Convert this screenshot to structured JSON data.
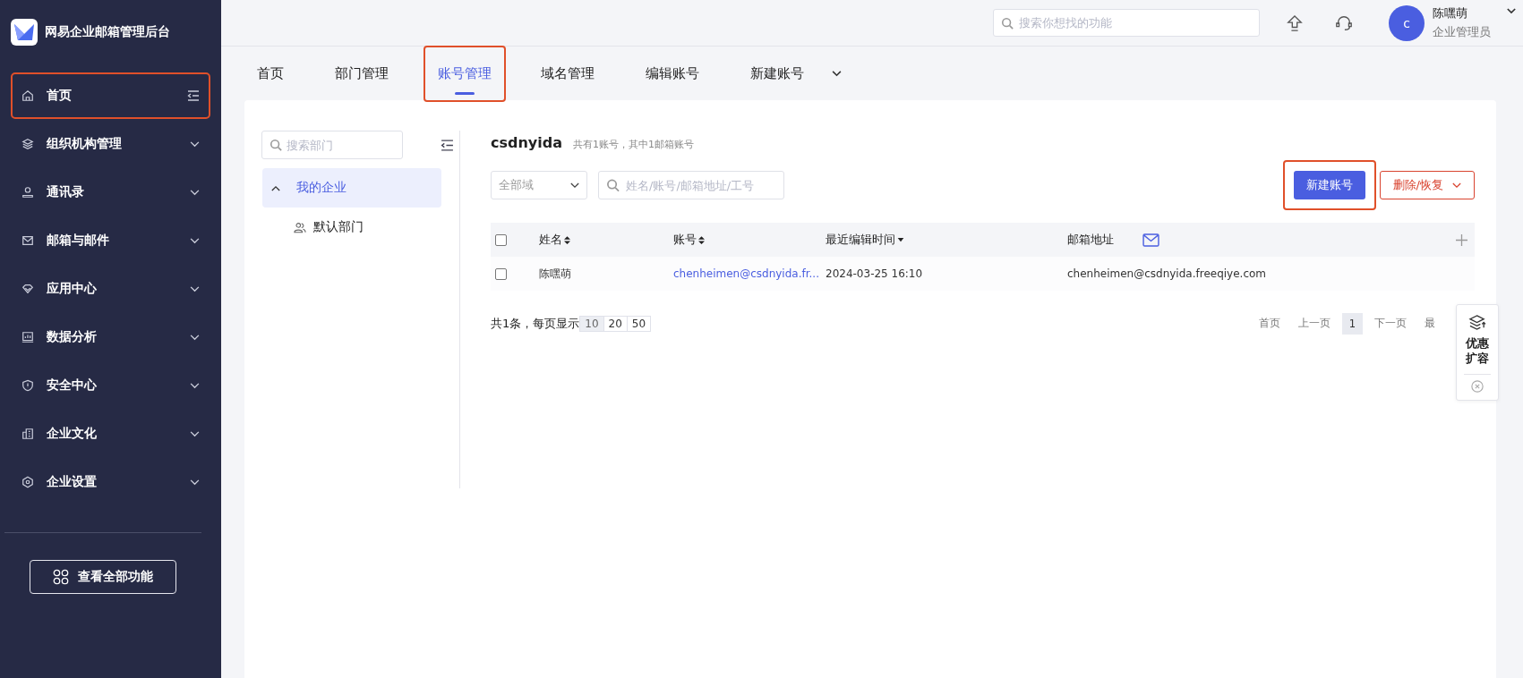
{
  "app": {
    "title": "网易企业邮箱管理后台"
  },
  "sidebar": {
    "items": [
      {
        "label": "首页",
        "kind": "collapse",
        "highlighted": true
      },
      {
        "label": "组织机构管理",
        "kind": "expand",
        "highlighted": false
      },
      {
        "label": "通讯录",
        "kind": "expand",
        "highlighted": false
      },
      {
        "label": "邮箱与邮件",
        "kind": "expand",
        "highlighted": false
      },
      {
        "label": "应用中心",
        "kind": "expand",
        "highlighted": false
      },
      {
        "label": "数据分析",
        "kind": "expand",
        "highlighted": false
      },
      {
        "label": "安全中心",
        "kind": "expand",
        "highlighted": false
      },
      {
        "label": "企业文化",
        "kind": "expand",
        "highlighted": false
      },
      {
        "label": "企业设置",
        "kind": "expand",
        "highlighted": false
      }
    ],
    "all_features_button": "查看全部功能"
  },
  "topbar": {
    "search": {
      "placeholder": "搜索你想找的功能"
    },
    "user": {
      "avatar": "c",
      "name": "陈嘿萌",
      "role": "企业管理员"
    }
  },
  "tabs": [
    {
      "label": "首页",
      "selected": false,
      "highlighted": false
    },
    {
      "label": "部门管理",
      "selected": false,
      "highlighted": false
    },
    {
      "label": "账号管理",
      "selected": true,
      "highlighted": true
    },
    {
      "label": "域名管理",
      "selected": false,
      "highlighted": false
    },
    {
      "label": "编辑账号",
      "selected": false,
      "highlighted": false
    },
    {
      "label": "新建账号",
      "selected": false,
      "highlighted": false
    }
  ],
  "departments": {
    "search": {
      "placeholder": "搜索部门"
    },
    "tree": [
      {
        "label": "我的企业",
        "expanded": true,
        "selected": true,
        "children": [
          {
            "label": "默认部门",
            "selected": false
          }
        ]
      }
    ]
  },
  "accounts": {
    "title": "csdnyida",
    "summary": "共有1账号，其中1邮箱账号",
    "domain_filter": {
      "value": "全部域"
    },
    "search": {
      "placeholder": "姓名/账号/邮箱地址/工号"
    },
    "new_button": {
      "label": "新建账号",
      "highlighted": true
    },
    "delete_button": {
      "label": "删除/恢复"
    },
    "table": {
      "header_checked": false,
      "columns": [
        {
          "label": "姓名",
          "sortable": true,
          "sorted_desc": false
        },
        {
          "label": "账号",
          "sortable": true,
          "sorted_desc": false
        },
        {
          "label": "最近编辑时间",
          "sortable": true,
          "sorted_desc": true
        },
        {
          "label": "邮箱地址",
          "sortable": false
        }
      ],
      "rows": [
        {
          "checked": false,
          "name": "陈嘿萌",
          "account": "chenheimen@csdnyida.fr...",
          "edited": "2024-03-25 16:10",
          "email": "chenheimen@csdnyida.freeqiye.com"
        }
      ]
    },
    "pagination": {
      "summary": "共1条，每页显示",
      "sizes": [
        {
          "label": "10",
          "selected": true
        },
        {
          "label": "20",
          "selected": false
        },
        {
          "label": "50",
          "selected": false
        }
      ],
      "pages": [
        {
          "label": "首页",
          "selected": false
        },
        {
          "label": "上一页",
          "selected": false
        },
        {
          "label": "1",
          "selected": true
        },
        {
          "label": "下一页",
          "selected": false
        },
        {
          "label": "最",
          "selected": false
        }
      ]
    }
  },
  "promo": {
    "label": "优惠扩容"
  }
}
